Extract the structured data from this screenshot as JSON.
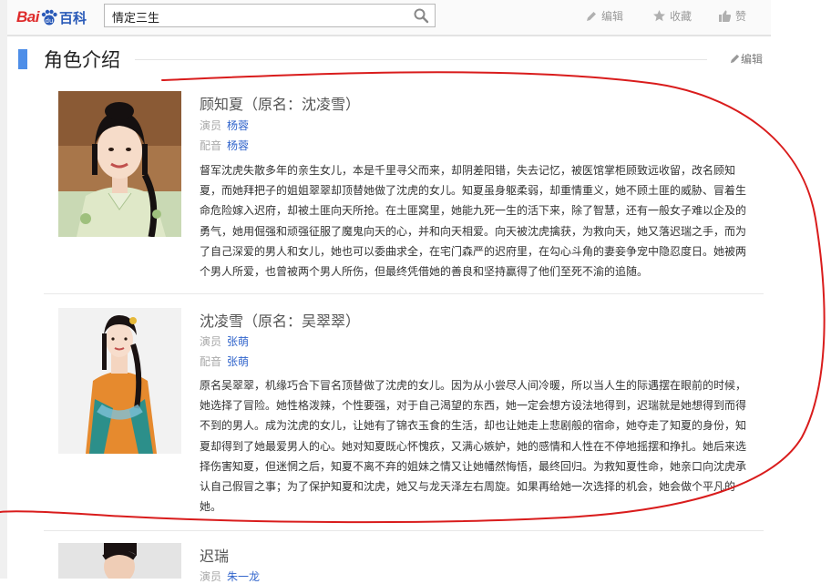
{
  "header": {
    "logo_bai": "Bai",
    "logo_baike": "百科",
    "search_value": "情定三生",
    "actions": [
      {
        "label": "编辑",
        "icon": "pencil-icon"
      },
      {
        "label": "收藏",
        "icon": "star-icon"
      },
      {
        "label": "赞",
        "icon": "thumbs-up-icon"
      }
    ]
  },
  "section": {
    "title": "角色介绍",
    "edit_label": "编辑"
  },
  "roles": [
    {
      "name": "顾知夏（原名：沈凌雪）",
      "actor_label": "演员",
      "actor": "杨蓉",
      "voice_label": "配音",
      "voice": "杨蓉",
      "description": "督军沈虎失散多年的亲生女儿，本是千里寻父而来，却阴差阳错，失去记忆，被医馆掌柜顾致远收留，改名顾知夏，而她拜把子的姐姐翠翠却顶替她做了沈虎的女儿。知夏虽身躯柔弱，却重情重义，她不顾土匪的威胁、冒着生命危险嫁入迟府，却被土匪向天所抢。在土匪窝里，她能九死一生的活下来，除了智慧，还有一般女子难以企及的勇气，她用倔强和顽强征服了魔鬼向天的心，并和向天相爱。向天被沈虎擒获，为救向天，她又落迟瑞之手，而为了自己深爱的男人和女儿，她也可以委曲求全，在宅门森严的迟府里，在勾心斗角的妻妾争宠中隐忍度日。她被两个男人所爱，也曾被两个男人所伤，但最终凭借她的善良和坚持赢得了他们至死不渝的追随。"
    },
    {
      "name": "沈凌雪（原名：吴翠翠）",
      "actor_label": "演员",
      "actor": "张萌",
      "voice_label": "配音",
      "voice": "张萌",
      "description": "原名吴翠翠，机缘巧合下冒名顶替做了沈虎的女儿。因为从小尝尽人间冷暖，所以当人生的际遇摆在眼前的时候，她选择了冒险。她性格泼辣，个性要强，对于自己渴望的东西，她一定会想方设法地得到，迟瑞就是她想得到而得不到的男人。成为沈虎的女儿，让她有了锦衣玉食的生活，却也让她走上悲剧般的宿命，她夺走了知夏的身份，知夏却得到了她最爱男人的心。她对知夏既心怀愧疚，又满心嫉妒，她的感情和人性在不停地摇摆和挣扎。她后来选择伤害知夏，但迷惘之后，知夏不离不弃的姐妹之情又让她幡然悔悟，最终回归。为救知夏性命，她亲口向沈虎承认自己假冒之事；为了保护知夏和沈虎，她又与龙天泽左右周旋。如果再给她一次选择的机会，她会做个平凡的她。"
    },
    {
      "name": "迟瑞",
      "actor_label": "演员",
      "actor": "朱一龙"
    }
  ],
  "colors": {
    "accent_bar": "#4e8ee8",
    "link": "#3366cc",
    "logo_red": "#de2b2b",
    "logo_blue": "#2a5ab8",
    "annotation_red": "#d91c1c"
  }
}
